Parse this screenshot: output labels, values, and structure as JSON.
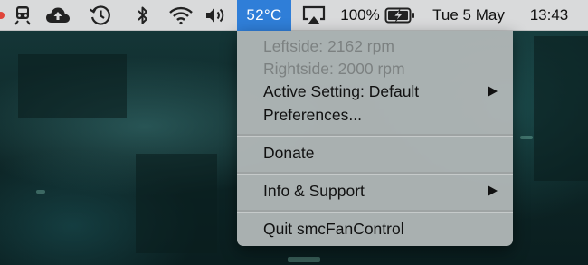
{
  "menubar": {
    "temperature": "52°C",
    "battery_percent": "100%",
    "date": "Tue 5 May",
    "time": "13:43",
    "icons": [
      "red-status-dot",
      "train-icon",
      "cloud-upload-icon",
      "time-machine-icon",
      "bluetooth-icon",
      "wifi-icon",
      "volume-icon",
      "airplay-icon",
      "battery-charging-icon"
    ],
    "active_highlight_color": "#2f7ed8"
  },
  "menu": {
    "leftside": "Leftside: 2162 rpm",
    "rightside": "Rightside: 2000 rpm",
    "active_setting": "Active Setting: Default",
    "preferences": "Preferences...",
    "donate": "Donate",
    "info_support": "Info & Support",
    "quit": "Quit smcFanControl"
  }
}
